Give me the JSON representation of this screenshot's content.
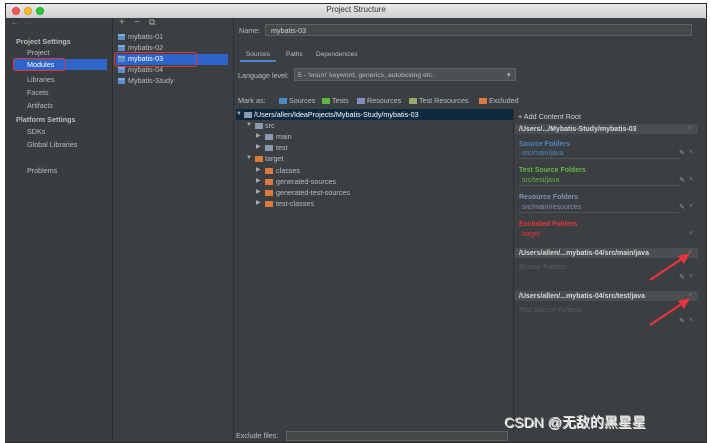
{
  "window": {
    "title": "Project Structure"
  },
  "nav": {
    "back": "←",
    "forward": "→",
    "add": "+",
    "remove": "−",
    "copy": "⧉"
  },
  "sidebar": {
    "project_settings_header": "Project Settings",
    "project_settings": [
      "Project",
      "Modules",
      "Libraries",
      "Facets",
      "Artifacts"
    ],
    "platform_settings_header": "Platform Settings",
    "platform_settings": [
      "SDKs",
      "Global Libraries"
    ],
    "problems": "Problems"
  },
  "modules": [
    "mybatis-01",
    "mybatis-02",
    "mybatis-03",
    "mybatis-04",
    "Mybatis-Study"
  ],
  "name_field": {
    "label": "Name:",
    "value": "mybatis-03"
  },
  "tabs": [
    "Sources",
    "Paths",
    "Dependencies"
  ],
  "language_level": {
    "label": "Language level:",
    "value": "5 - 'enum' keyword, generics, autoboxing etc."
  },
  "mark_as": {
    "label": "Mark as:",
    "items": [
      {
        "label": "Sources",
        "color": "#4a88c7"
      },
      {
        "label": "Tests",
        "color": "#62b543"
      },
      {
        "label": "Resources",
        "color": "#7f8fb8"
      },
      {
        "label": "Test Resources",
        "color": "#9aa86f"
      },
      {
        "label": "Excluded",
        "color": "#e07a3c"
      }
    ]
  },
  "tree": {
    "root": "/Users/allen/IdeaProjects/Mybatis-Study/mybatis-03",
    "src": "src",
    "main": "main",
    "test": "test",
    "target": "target",
    "classes": "classes",
    "generated_sources": "generated-sources",
    "generated_test_sources": "generated-test-sources",
    "test_classes": "test-classes"
  },
  "content_roots": {
    "add_label": "+ Add Content Root",
    "root1": {
      "path": "/Users/.../Mybatis-Study/mybatis-03",
      "source_folders_label": "Source Folders",
      "source_folder": "src/main/java",
      "test_source_folders_label": "Test Source Folders",
      "test_source_folder": "src/test/java",
      "resource_folders_label": "Resource Folders",
      "resource_folder": "src/main/resources",
      "excluded_folders_label": "Excluded Folders",
      "excluded_folder": "target"
    },
    "root2": {
      "path": "/Users/allen/...mybatis-04/src/main/java",
      "folders_label": "Source Folders"
    },
    "root3": {
      "path": "/Users/allen/...mybatis-04/src/test/java",
      "folders_label": "Test Source Folders"
    }
  },
  "exclude_files": {
    "label": "Exclude files:",
    "value": ""
  },
  "colors": {
    "source": "#4a88c7",
    "test": "#62b543",
    "resource": "#7f8fb8",
    "excluded": "#e8343c",
    "selection": "#2f65ca",
    "annotation": "#e8343c"
  },
  "watermark": "CSDN @无敌的黑星星"
}
